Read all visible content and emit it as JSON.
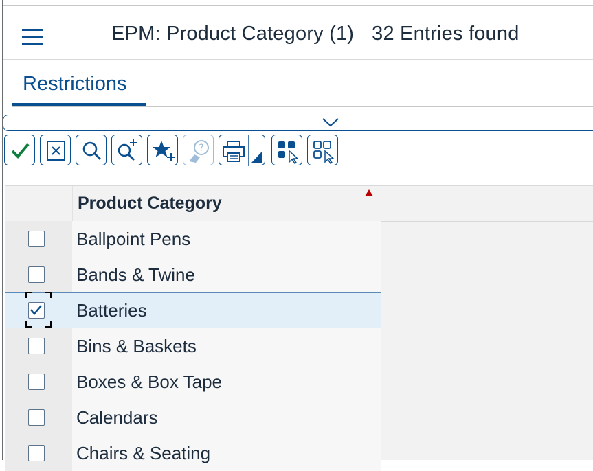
{
  "window": {
    "title": "EPM: Product Category (1)",
    "entries_found": "32 Entries found"
  },
  "tabs": [
    {
      "label": "Restrictions",
      "active": true
    }
  ],
  "toolbar": {
    "buttons": [
      {
        "icon": "checkmark-icon",
        "name": "confirm-button"
      },
      {
        "icon": "close-box-icon",
        "name": "cancel-button"
      },
      {
        "icon": "search-icon",
        "name": "find-button"
      },
      {
        "icon": "search-plus-icon",
        "name": "find-next-button"
      },
      {
        "icon": "star-plus-icon",
        "name": "add-favorite-button"
      },
      {
        "icon": "help-icon",
        "name": "help-button",
        "disabled": true
      },
      {
        "icon": "printer-icon",
        "name": "print-button"
      },
      {
        "icon": "select-all-icon",
        "name": "select-all-button"
      },
      {
        "icon": "deselect-all-icon",
        "name": "deselect-all-button"
      }
    ]
  },
  "table": {
    "column_header": "Product Category",
    "sort": "ascending",
    "rows": [
      {
        "label": "Ballpoint Pens",
        "checked": false
      },
      {
        "label": "Bands & Twine",
        "checked": false
      },
      {
        "label": "Batteries",
        "checked": true
      },
      {
        "label": "Bins & Baskets",
        "checked": false
      },
      {
        "label": "Boxes & Box Tape",
        "checked": false
      },
      {
        "label": "Calendars",
        "checked": false
      },
      {
        "label": "Chairs & Seating",
        "checked": false
      }
    ]
  },
  "colors": {
    "accent": "#0a4f8f",
    "confirm_green": "#107e3e",
    "sort_red": "#bb0000",
    "selected_row": "#e2eef8"
  }
}
